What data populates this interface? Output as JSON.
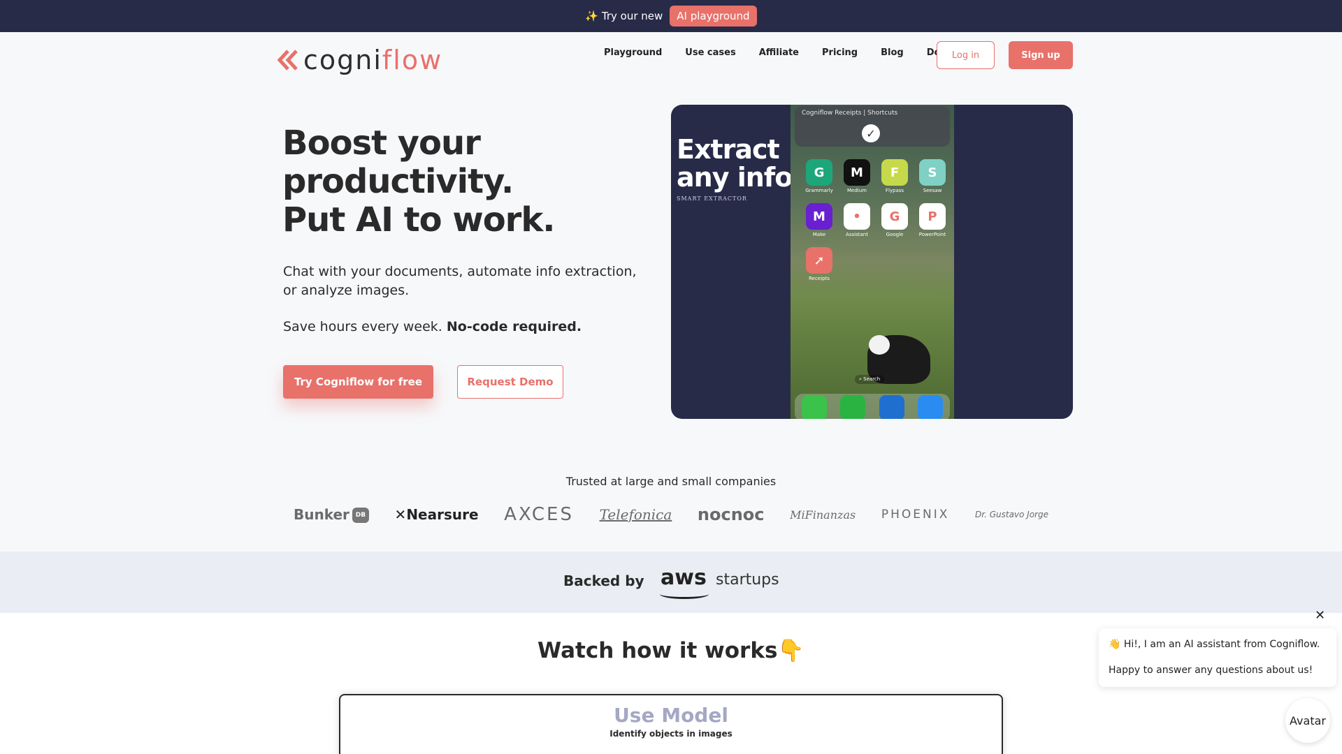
{
  "announcement": {
    "icon": "sparkles-icon",
    "text": "✨ Try our new",
    "pill": "AI playground"
  },
  "header": {
    "logo_prefix": "cogni",
    "logo_accent": "flow",
    "nav": [
      "Playground",
      "Use cases",
      "Affiliate",
      "Pricing",
      "Blog",
      "Docs"
    ],
    "login": "Log in",
    "signup": "Sign up"
  },
  "hero": {
    "title_lines": [
      "Boost your",
      "productivity.",
      "Put AI to work."
    ],
    "description": "Chat with your documents, automate info extraction, or analyze images.",
    "save_text": "Save hours every week.",
    "save_bold": "No-code required.",
    "cta_primary": "Try Cogniflow for free",
    "cta_secondary": "Request Demo"
  },
  "media": {
    "title_line1": "Extract",
    "title_line2": "any info",
    "subtitle": "SMART EXTRACTOR",
    "notification": "Cogniflow Receipts | Shortcuts",
    "apps": [
      {
        "label": "Grammarly",
        "color": "#1ea67b",
        "glyph": "G"
      },
      {
        "label": "Medium",
        "color": "#111111",
        "glyph": "M"
      },
      {
        "label": "Flypass",
        "color": "#c6d94a",
        "glyph": "F"
      },
      {
        "label": "Seesaw",
        "color": "#7fd0c5",
        "glyph": "S"
      },
      {
        "label": "Make",
        "color": "#6a1fd1",
        "glyph": "M"
      },
      {
        "label": "Assistant",
        "color": "#ffffff",
        "glyph": "•"
      },
      {
        "label": "Google",
        "color": "#ffffff",
        "glyph": "G"
      },
      {
        "label": "PowerPoint",
        "color": "#ffffff",
        "glyph": "P"
      },
      {
        "label": "Receipts",
        "color": "#e8716a",
        "glyph": "➚"
      }
    ],
    "search": "Search",
    "dock_colors": [
      "#3bc24a",
      "#2bb341",
      "#1e6fd0",
      "#2a8cf0"
    ]
  },
  "trusted": {
    "heading": "Trusted at large and small companies",
    "logos": [
      "Bunker",
      "Nearsure",
      "AXCES",
      "Telefonica",
      "nocnoc",
      "MiFinanzas",
      "PHOENIX",
      "Dr. Gustavo Jorge"
    ],
    "bunker_badge": "DB"
  },
  "backed": {
    "label": "Backed by",
    "aws": "aws",
    "startups": "startups"
  },
  "watch": {
    "heading": "Watch how it works👇"
  },
  "video": {
    "title": "Use Model",
    "subtitle": "Identify objects in images"
  },
  "chat": {
    "close": "✕",
    "line1": "👋 Hi!, I am an AI assistant from Cogniflow.",
    "line2": "Happy to answer any questions about us!",
    "avatar_alt": "Avatar"
  }
}
